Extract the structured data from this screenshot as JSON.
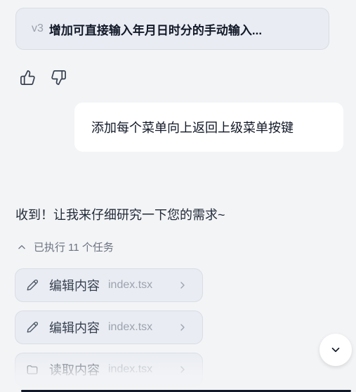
{
  "version_card": {
    "tag": "v3",
    "title": "增加可直接输入年月日时分的手动输入..."
  },
  "feedback": {
    "like_icon": "thumbs-up-icon",
    "dislike_icon": "thumbs-down-icon"
  },
  "user_message": {
    "text": "添加每个菜单向上返回上级菜单按键"
  },
  "assistant_message": {
    "text": "收到！让我来仔细研究一下您的需求~"
  },
  "tasks": {
    "toggle_label": "已执行 11 个任务",
    "items": [
      {
        "icon": "pencil-icon",
        "label": "编辑内容",
        "file": "index.tsx"
      },
      {
        "icon": "pencil-icon",
        "label": "编辑内容",
        "file": "index.tsx"
      },
      {
        "icon": "folder-icon",
        "label": "读取内容",
        "file": "index.tsx"
      }
    ]
  },
  "scroll_button": {
    "icon": "chevron-down-icon"
  }
}
